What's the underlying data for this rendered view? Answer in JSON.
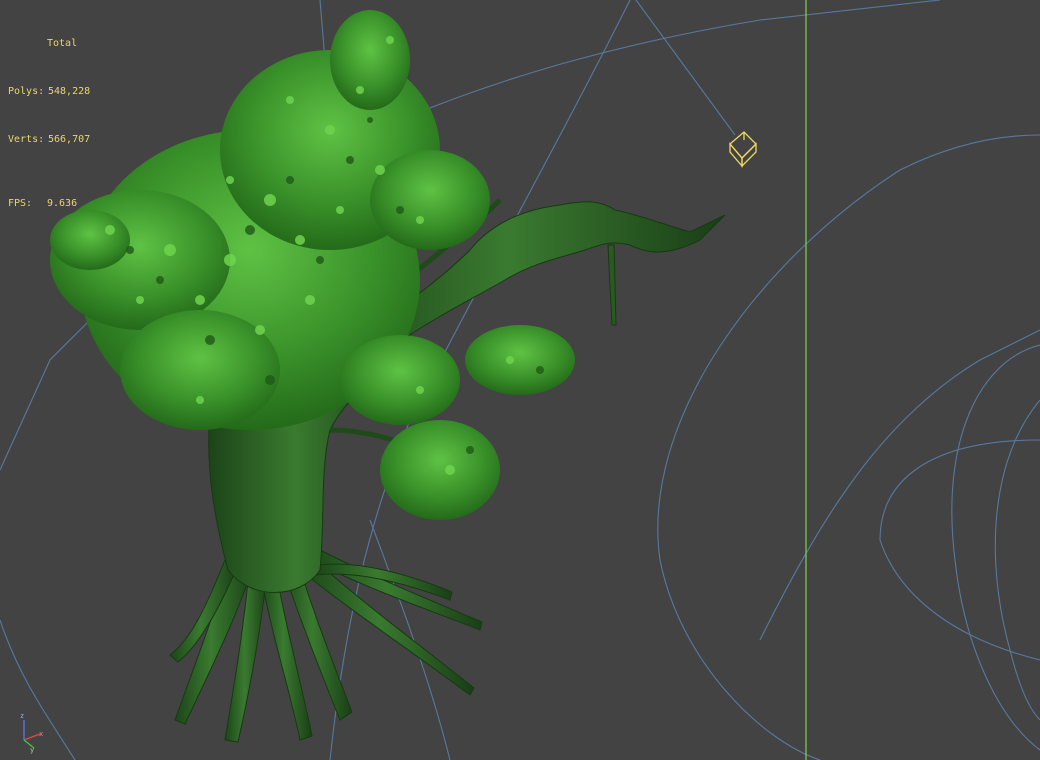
{
  "viewport": {
    "stats": {
      "total_label": "Total",
      "polys_label": "Polys:",
      "polys_value": "548,228",
      "verts_label": "Verts:",
      "verts_value": "566,707",
      "fps_label": "FPS:",
      "fps_value": "9.636"
    },
    "axis": {
      "x_label": "x",
      "y_label": "y",
      "z_label": "z"
    }
  },
  "colors": {
    "viewport_background": "#434343",
    "stats_text": "#e8d868",
    "grid_line_green": "#7fd44a",
    "wire_blue": "#5a7fa8",
    "light_gizmo": "#f0d860",
    "leaf_dark": "#2a6b1e",
    "leaf_mid": "#3f9a2c",
    "leaf_light": "#5cc040",
    "bark_dark": "#1f4a1a",
    "bark_mid": "#2f6a26",
    "bark_light": "#4a8a3a"
  }
}
